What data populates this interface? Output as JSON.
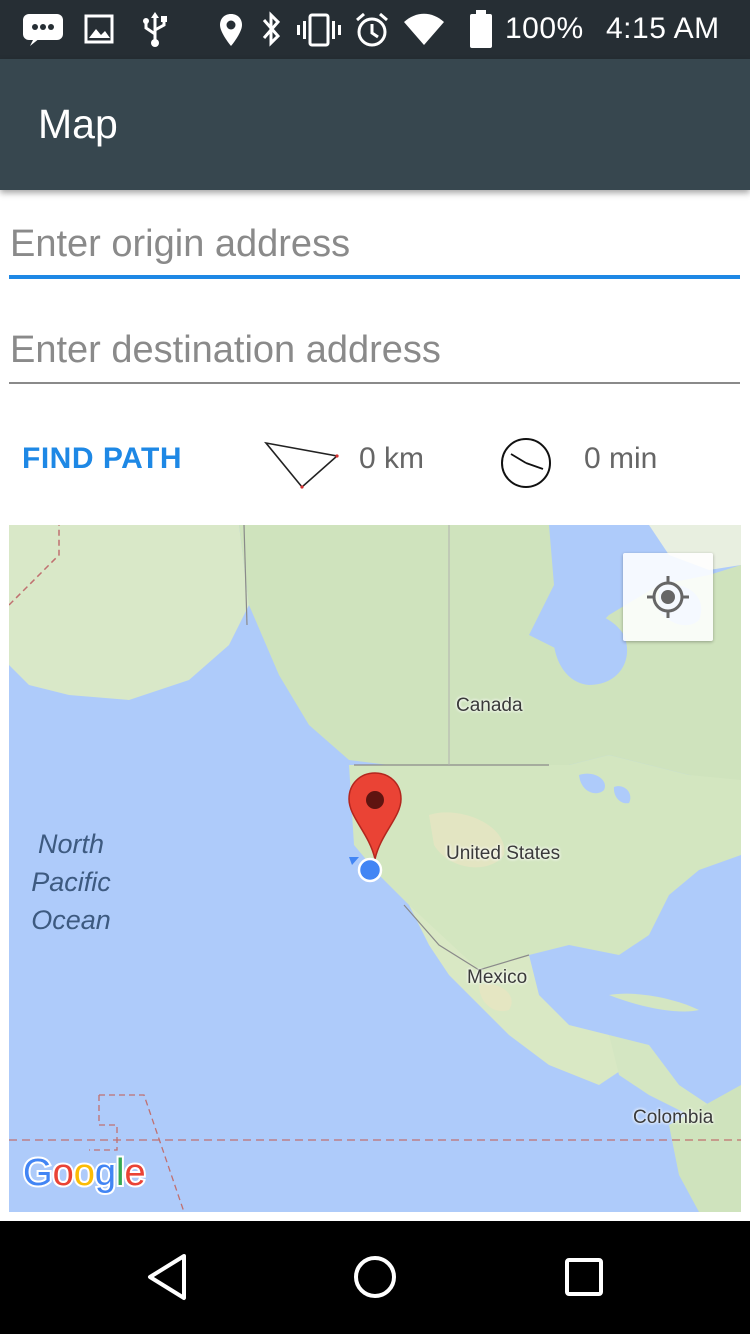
{
  "status_bar": {
    "battery_percent": "100%",
    "time": "4:15 AM",
    "icons": [
      "messaging-icon",
      "image-icon",
      "usb-icon",
      "location-icon",
      "bluetooth-icon",
      "vibrate-icon",
      "alarm-icon",
      "wifi-icon",
      "battery-icon"
    ]
  },
  "app_bar": {
    "title": "Map"
  },
  "form": {
    "origin_placeholder": "Enter origin address",
    "origin_value": "",
    "destination_placeholder": "Enter destination address",
    "destination_value": ""
  },
  "actions": {
    "find_path_label": "FIND PATH",
    "distance": "0 km",
    "duration": "0 min"
  },
  "map": {
    "labels": {
      "canada": "Canada",
      "united_states": "United States",
      "mexico": "Mexico",
      "colombia": "Colombia",
      "ocean_line1": "North",
      "ocean_line2": "Pacific",
      "ocean_line3": "Ocean"
    },
    "attribution": "Google"
  },
  "colors": {
    "status_bar": "#262e34",
    "app_bar": "#37474f",
    "accent": "#1e88e5",
    "water": "#aecbfa",
    "land": "#c8e0b0",
    "marker": "#ea4335"
  }
}
